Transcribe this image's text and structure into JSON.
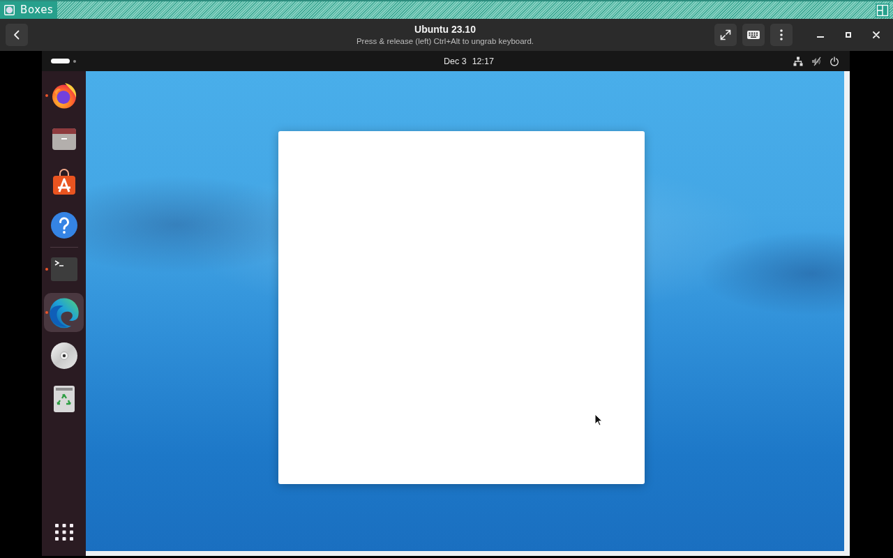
{
  "app_bar": {
    "title": "Boxes"
  },
  "header": {
    "title": "Ubuntu 23.10",
    "subtitle": "Press & release (left) Ctrl+Alt to ungrab keyboard."
  },
  "guest": {
    "top_bar": {
      "workspaces": [
        {
          "selected": true
        },
        {
          "selected": false
        }
      ],
      "date": "Dec 3",
      "time": "12:17"
    },
    "dock": {
      "favorites": [
        {
          "kind": "flame_browser",
          "running": true,
          "selected": false
        },
        {
          "kind": "files",
          "running": false,
          "selected": false
        },
        {
          "kind": "software",
          "running": false,
          "selected": false
        },
        {
          "kind": "help",
          "running": false,
          "selected": false
        }
      ],
      "others": [
        {
          "kind": "terminal",
          "running": true,
          "selected": false
        },
        {
          "kind": "swirl_browser",
          "running": true,
          "selected": true
        },
        {
          "kind": "disc",
          "running": false,
          "selected": false
        },
        {
          "kind": "trash",
          "running": false,
          "selected": false
        }
      ]
    }
  }
}
